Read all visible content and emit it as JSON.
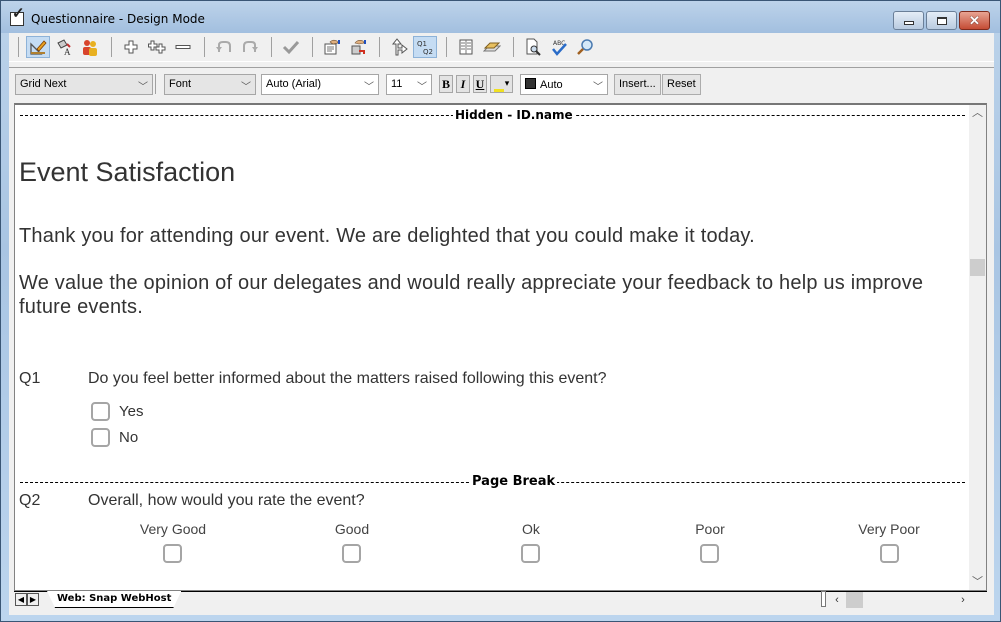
{
  "window": {
    "title": "Questionnaire - Design Mode",
    "controls": {
      "minimize": "minimize",
      "maximize": "maximize",
      "close": "close"
    }
  },
  "toolbar": {
    "icons": [
      {
        "name": "design-mode-icon",
        "active": true
      },
      {
        "name": "paint-format-icon",
        "active": false
      },
      {
        "name": "users-icon",
        "active": false
      },
      {
        "name": "add-question-icon",
        "active": false
      },
      {
        "name": "add-multiple-icon",
        "active": false
      },
      {
        "name": "remove-icon",
        "active": false
      },
      {
        "name": "undo-icon",
        "active": false
      },
      {
        "name": "redo-icon",
        "active": false
      },
      {
        "name": "check-icon",
        "active": false
      },
      {
        "name": "properties-icon",
        "active": false
      },
      {
        "name": "routing-icon",
        "active": false
      },
      {
        "name": "branch-icon",
        "active": false
      },
      {
        "name": "question-numbering-icon",
        "active": true,
        "text": "Q1 Q2"
      },
      {
        "name": "layout-icon",
        "active": false
      },
      {
        "name": "styles-icon",
        "active": false
      },
      {
        "name": "preview-icon",
        "active": false
      },
      {
        "name": "spellcheck-icon",
        "active": false
      },
      {
        "name": "find-icon",
        "active": false
      }
    ]
  },
  "format_bar": {
    "style_select": "Grid Next",
    "element_select": "Font",
    "font_select": "Auto (Arial)",
    "size_select": "11",
    "bold": "B",
    "italic": "I",
    "underline": "U",
    "color_select": "Auto",
    "insert_button": "Insert...",
    "reset_button": "Reset"
  },
  "document": {
    "hidden_marker": "Hidden - ID.name",
    "title": "Event Satisfaction",
    "intro": "Thank you for attending our event. We are delighted that you could make it today.",
    "body_line1": "We value the opinion of our delegates and would really appreciate your feedback to help us improve",
    "body_line2": "future events.",
    "questions": [
      {
        "number": "Q1",
        "text": "Do you feel better informed about the matters raised following this event?",
        "options": [
          "Yes",
          "No"
        ]
      },
      {
        "number": "Q2",
        "text": "Overall, how would you rate the event?",
        "options": [
          "Very Good",
          "Good",
          "Ok",
          "Poor",
          "Very Poor"
        ]
      }
    ],
    "page_break": "Page Break"
  },
  "bottom": {
    "sheet_tab": "Web: Snap WebHost"
  }
}
